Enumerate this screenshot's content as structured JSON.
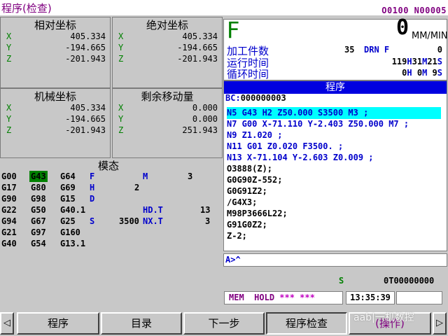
{
  "header": {
    "title": "程序(检查)",
    "program_numbers": "O0100 N00005"
  },
  "coords": {
    "relative": {
      "title": "相对坐标",
      "rows": [
        {
          "axis": "X",
          "value": "405.334"
        },
        {
          "axis": "Y",
          "value": "-194.665"
        },
        {
          "axis": "Z",
          "value": "-201.943"
        }
      ]
    },
    "absolute": {
      "title": "绝对坐标",
      "rows": [
        {
          "axis": "X",
          "value": "405.334"
        },
        {
          "axis": "Y",
          "value": "-194.665"
        },
        {
          "axis": "Z",
          "value": "-201.943"
        }
      ]
    },
    "machine": {
      "title": "机械坐标",
      "rows": [
        {
          "axis": "X",
          "value": "405.334"
        },
        {
          "axis": "Y",
          "value": "-194.665"
        },
        {
          "axis": "Z",
          "value": "-201.943"
        }
      ]
    },
    "distance_to_go": {
      "title": "剩余移动量",
      "rows": [
        {
          "axis": "X",
          "value": "0.000"
        },
        {
          "axis": "Y",
          "value": "0.000"
        },
        {
          "axis": "Z",
          "value": "251.943"
        }
      ]
    }
  },
  "feed": {
    "label": "F",
    "value": "0",
    "unit": "MM/MIN"
  },
  "info": {
    "parts_label": "加工件数",
    "parts_count": "35",
    "drn_f_label": "DRN F",
    "drn_f_value": "0",
    "run_time_label": "运行时间",
    "run_h": "119",
    "run_m": "31",
    "run_s": "21",
    "cycle_time_label": "循环时间",
    "cyc_h": "0",
    "cyc_m": "0",
    "cyc_s": "9",
    "h_unit": "H",
    "m_unit": "M",
    "s_unit": "S"
  },
  "program": {
    "bar_title": "程序",
    "bc_label": "BC:",
    "bc_value": "000000003",
    "lines": [
      "N5 G43 H2 Z50.000 S3500 M3 ;",
      "N7 G00 X-71.110 Y-2.403 Z50.000 M7 ;",
      "N9 Z1.020 ;",
      "N11 G01 Z0.020 F3500. ;",
      "N13 X-71.104 Y-2.603 Z0.009 ;",
      "O3888(Z);",
      "G0G90Z-552;",
      "G0G91Z2;",
      "/G4X3;",
      "M98P3666L22;",
      "G91G0Z2;",
      "Z-2;"
    ]
  },
  "input": {
    "prompt": "A>^"
  },
  "modal": {
    "title": "模态",
    "col1": [
      "G00",
      "G17",
      "G90",
      "G22",
      "G94",
      "G21",
      "G40"
    ],
    "col2": [
      "G43",
      "G80",
      "G98",
      "G50",
      "G67",
      "G97",
      "G54"
    ],
    "col3": [
      "G64",
      "G69",
      "G15",
      "G40.1",
      "G25",
      "G160",
      "G13.1"
    ],
    "f_label": "F",
    "m_label": "M",
    "m_value": "3",
    "h_label": "H",
    "h_value": "2",
    "d_label": "D",
    "hd_t_label": "HD.T",
    "hd_t_value": "13",
    "s_label": "S",
    "s_value": "3500",
    "nx_t_label": "NX.T",
    "nx_t_value": "3"
  },
  "spindle": {
    "label": "S",
    "value": "0T00000000"
  },
  "status": {
    "mode": "MEM",
    "state": "HOLD",
    "stars": "*** ***",
    "time": "13:35:39"
  },
  "softkeys": {
    "left_arrow": "◁",
    "program": "程序",
    "directory": "目录",
    "next_step": "下一步",
    "program_check": "程序检查",
    "operation": "(操作)",
    "right_arrow": "▷"
  },
  "watermark": "aab|一机数控",
  "colors": {
    "background": "#c8c8c8",
    "blue_text": "#0000cc",
    "green_axis": "#008000",
    "purple_header": "#800080",
    "highlight_cyan": "#00ffff",
    "program_bar": "#0000e0"
  }
}
